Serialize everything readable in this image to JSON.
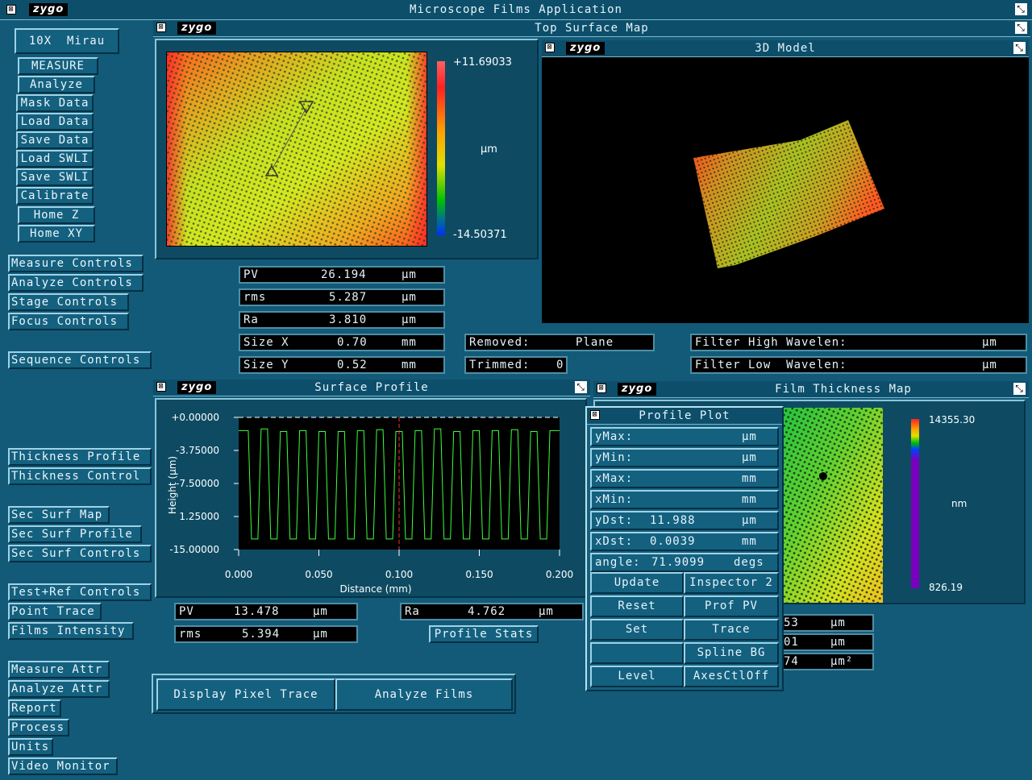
{
  "app": {
    "title": "Microscope Films Application",
    "logo": "zygo"
  },
  "objective": "10X  Mirau",
  "left_top_buttons": [
    "MEASURE",
    "Analyze",
    "Mask Data",
    "Load Data",
    "Save Data",
    "Load SWLI",
    "Save SWLI",
    "Calibrate",
    "Home Z",
    "Home XY"
  ],
  "left_buttons": {
    "measure_controls": "Measure Controls",
    "analyze_controls": "Analyze Controls",
    "stage_controls": "Stage Controls",
    "focus_controls": "Focus Controls",
    "sequence_controls": "Sequence Controls",
    "thickness_profile": "Thickness Profile",
    "thickness_control": "Thickness Control",
    "sec_surf_map": "Sec Surf Map",
    "sec_surf_profile": "Sec Surf Profile",
    "sec_surf_controls": "Sec Surf Controls",
    "test_ref_controls": "Test+Ref Controls",
    "point_trace": "Point Trace",
    "films_intensity": "Films Intensity",
    "measure_attr": "Measure Attr",
    "analyze_attr": "Analyze Attr",
    "report": "Report",
    "process": "Process",
    "units": "Units",
    "video_monitor": "Video Monitor"
  },
  "top_surface": {
    "title": "Top Surface Map",
    "scale_max": "+11.69033",
    "scale_min": "-14.50371",
    "scale_unit": "µm"
  },
  "model3d": {
    "title": "3D Model"
  },
  "surface_stats": {
    "pv": {
      "label": "PV",
      "value": "26.194",
      "unit": "µm"
    },
    "rms": {
      "label": "rms",
      "value": "5.287",
      "unit": "µm"
    },
    "ra": {
      "label": "Ra",
      "value": "3.810",
      "unit": "µm"
    },
    "size_x": {
      "label": "Size X",
      "value": "0.70",
      "unit": "mm"
    },
    "size_y": {
      "label": "Size Y",
      "value": "0.52",
      "unit": "mm"
    }
  },
  "removed": {
    "label": "Removed:",
    "value": "Plane"
  },
  "trimmed": {
    "label": "Trimmed:",
    "value": "0"
  },
  "filter_high": {
    "label": "Filter High Wavelen:",
    "unit": "µm"
  },
  "filter_low": {
    "label": "Filter Low  Wavelen:",
    "unit": "µm"
  },
  "profile": {
    "title": "Surface Profile",
    "stats": {
      "pv": {
        "label": "PV",
        "value": "13.478",
        "unit": "µm"
      },
      "rms": {
        "label": "rms",
        "value": "5.394",
        "unit": "µm"
      },
      "ra": {
        "label": "Ra",
        "value": "4.762",
        "unit": "µm"
      }
    },
    "stats_button": "Profile Stats"
  },
  "chart_data": {
    "type": "line",
    "title": "",
    "xlabel": "Distance (mm)",
    "ylabel": "Height (µm)",
    "xlim": [
      0.0,
      0.2
    ],
    "ylim": [
      -15.0,
      0.0
    ],
    "x_ticks": [
      "0.000",
      "0.050",
      "0.100",
      "0.150",
      "0.200"
    ],
    "y_ticks": [
      "+0.00000",
      "-3.75000",
      "-7.50000",
      "1.25000",
      "-15.00000"
    ],
    "x_tick_values": [
      0.0,
      0.05,
      0.1,
      0.15,
      0.2
    ],
    "y_tick_values": [
      0.0,
      -3.75,
      -7.5,
      -11.25,
      -15.0
    ],
    "cursor_x": 0.1,
    "series": [
      {
        "color": "#3cff3c",
        "x": [
          0.0,
          0.006,
          0.008,
          0.012,
          0.014,
          0.018,
          0.02,
          0.024,
          0.026,
          0.03,
          0.032,
          0.036,
          0.038,
          0.042,
          0.044,
          0.048,
          0.05,
          0.054,
          0.056,
          0.06,
          0.062,
          0.066,
          0.068,
          0.072,
          0.074,
          0.078,
          0.08,
          0.084,
          0.086,
          0.09,
          0.092,
          0.096,
          0.098,
          0.102,
          0.104,
          0.108,
          0.11,
          0.114,
          0.116,
          0.12,
          0.122,
          0.126,
          0.128,
          0.132,
          0.134,
          0.138,
          0.14,
          0.144,
          0.146,
          0.15,
          0.152,
          0.156,
          0.158,
          0.162,
          0.164,
          0.168,
          0.17,
          0.174,
          0.176,
          0.18,
          0.182,
          0.186,
          0.188,
          0.192,
          0.194,
          0.2
        ],
        "y": [
          -1.5,
          -1.5,
          -13.8,
          -13.8,
          -1.3,
          -1.3,
          -13.8,
          -13.8,
          -1.6,
          -1.6,
          -13.8,
          -13.8,
          -1.5,
          -1.5,
          -13.8,
          -13.8,
          -1.6,
          -1.6,
          -13.8,
          -13.8,
          -1.6,
          -1.6,
          -13.8,
          -13.8,
          -1.5,
          -1.5,
          -13.8,
          -13.8,
          -1.4,
          -1.4,
          -13.8,
          -13.8,
          -1.6,
          -1.6,
          -13.8,
          -13.8,
          -1.5,
          -1.5,
          -13.8,
          -13.8,
          -1.3,
          -1.3,
          -13.8,
          -13.8,
          -1.6,
          -1.6,
          -13.8,
          -13.8,
          -1.5,
          -1.5,
          -13.8,
          -13.8,
          -1.5,
          -1.5,
          -13.8,
          -13.8,
          -1.4,
          -1.4,
          -13.8,
          -13.8,
          -1.6,
          -1.6,
          -13.8,
          -13.8,
          -1.5,
          -1.5
        ]
      }
    ]
  },
  "film_map": {
    "title": "Film Thickness Map",
    "scale_max": "14355.30",
    "scale_min": "826.19",
    "scale_unit": "nm",
    "partial_rows": [
      {
        "value": "53",
        "unit": "µm"
      },
      {
        "value": "01",
        "unit": "µm"
      },
      {
        "value": "74",
        "unit": "µm²"
      }
    ]
  },
  "profile_plot": {
    "title": "Profile Plot",
    "rows": [
      {
        "label": "yMax:",
        "value": "",
        "unit": "µm"
      },
      {
        "label": "yMin:",
        "value": "",
        "unit": "µm"
      },
      {
        "label": "xMax:",
        "value": "",
        "unit": "mm"
      },
      {
        "label": "xMin:",
        "value": "",
        "unit": "mm"
      },
      {
        "label": "yDst:",
        "value": "11.988",
        "unit": "µm"
      },
      {
        "label": "xDst:",
        "value": "0.0039",
        "unit": "mm"
      },
      {
        "label": "angle:",
        "value": "71.9099",
        "unit": "degs"
      }
    ],
    "buttons": {
      "update": "Update",
      "inspector2": "Inspector 2",
      "reset": "Reset",
      "prof_pv": "Prof PV",
      "set": "Set",
      "trace": "Trace",
      "spline_bg": "Spline BG",
      "level": "Level",
      "axes_ctl_off": "AxesCtlOff"
    }
  },
  "bottom_buttons": {
    "display_pixel_trace": "Display Pixel Trace",
    "analyze_films": "Analyze Films"
  },
  "colors": {
    "background": "#125a78",
    "titlebar": "#0d4f6b",
    "bevel_light": "#9fd3e6",
    "bevel_dark": "#053044",
    "field_bg": "#000000"
  }
}
